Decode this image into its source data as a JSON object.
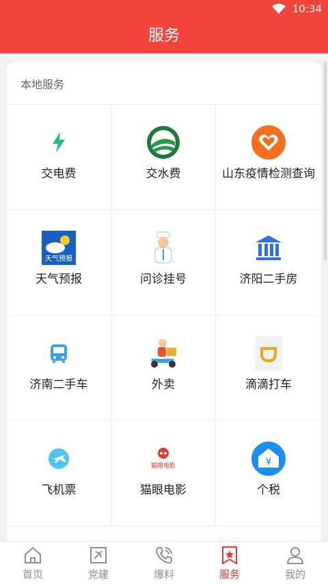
{
  "status_bar": {
    "time": "10:34"
  },
  "header": {
    "title": "服务"
  },
  "section": {
    "title": "本地服务",
    "items": [
      {
        "label": "交电费",
        "icon": "lightning-icon"
      },
      {
        "label": "交水费",
        "icon": "water-logo-icon"
      },
      {
        "label": "山东疫情检测查询",
        "icon": "heart-icon"
      },
      {
        "label": "天气预报",
        "icon": "weather-icon",
        "icon_text": "天气预报"
      },
      {
        "label": "问诊挂号",
        "icon": "doctor-icon"
      },
      {
        "label": "济阳二手房",
        "icon": "bank-building-icon"
      },
      {
        "label": "济南二手车",
        "icon": "bus-icon"
      },
      {
        "label": "外卖",
        "icon": "delivery-icon"
      },
      {
        "label": "滴滴打车",
        "icon": "didi-icon"
      },
      {
        "label": "飞机票",
        "icon": "plane-icon"
      },
      {
        "label": "猫眼电影",
        "icon": "maoyan-logo-icon",
        "icon_text": "猫眼电影"
      },
      {
        "label": "个税",
        "icon": "tax-icon",
        "icon_text": "¥"
      }
    ]
  },
  "tabbar": {
    "active": "服务",
    "tabs": [
      {
        "label": "首页",
        "icon": "home-icon"
      },
      {
        "label": "党建",
        "icon": "party-icon"
      },
      {
        "label": "爆料",
        "icon": "phone-icon"
      },
      {
        "label": "服务",
        "icon": "bookmark-star-icon"
      },
      {
        "label": "我的",
        "icon": "user-icon"
      }
    ]
  },
  "colors": {
    "brand": "#f4453d",
    "active_tab": "#e8382f"
  }
}
